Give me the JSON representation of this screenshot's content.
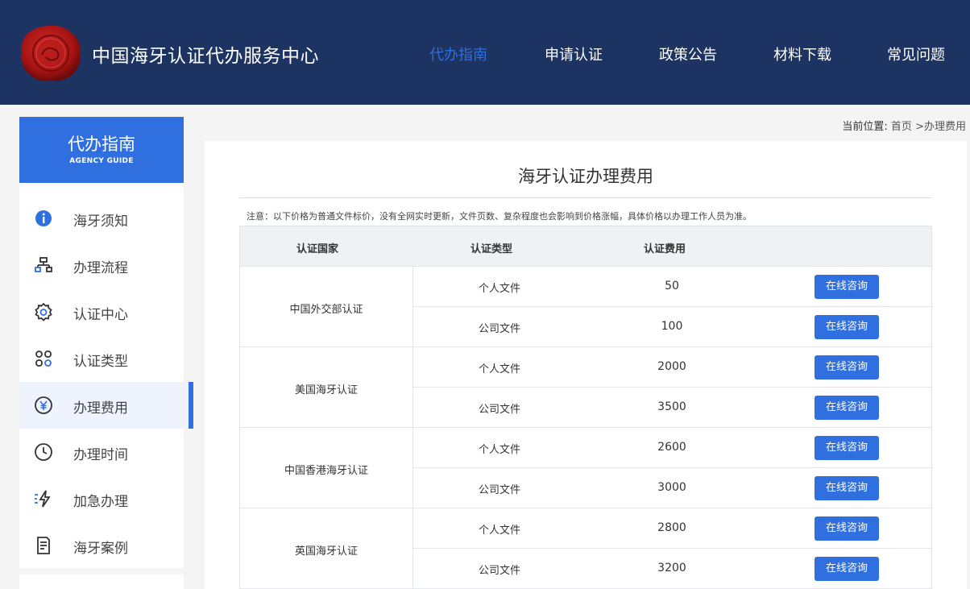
{
  "header": {
    "site_title": "中国海牙认证代办服务中心",
    "logo_icon": "wax-seal-icon",
    "nav": [
      {
        "label": "代办指南",
        "active": true
      },
      {
        "label": "申请认证",
        "active": false
      },
      {
        "label": "政策公告",
        "active": false
      },
      {
        "label": "材料下载",
        "active": false
      },
      {
        "label": "常见问题",
        "active": false
      }
    ]
  },
  "sidebar": {
    "title": "代办指南",
    "subtitle": "AGENCY GUIDE",
    "items": [
      {
        "label": "海牙须知",
        "icon": "info-icon"
      },
      {
        "label": "办理流程",
        "icon": "flowchart-icon"
      },
      {
        "label": "认证中心",
        "icon": "gear-badge-icon"
      },
      {
        "label": "认证类型",
        "icon": "category-icon"
      },
      {
        "label": "办理费用",
        "icon": "yuan-icon",
        "active": true
      },
      {
        "label": "办理时间",
        "icon": "clock-icon"
      },
      {
        "label": "加急办理",
        "icon": "lightning-icon"
      },
      {
        "label": "海牙案例",
        "icon": "document-icon"
      }
    ]
  },
  "breadcrumb": {
    "prefix": "当前位置:",
    "home": "首页",
    "sep": ">",
    "current": "办理费用"
  },
  "main": {
    "title": "海牙认证办理费用",
    "note": "注意：以下价格为普通文件标价，没有全网实时更新，文件页数、复杂程度也会影响到价格涨幅，具体价格以办理工作人员为准。",
    "table": {
      "headers": [
        "认证国家",
        "认证类型",
        "认证费用"
      ],
      "groups": [
        {
          "country": "中国外交部认证",
          "rows": [
            {
              "type": "个人文件",
              "fee": "50",
              "action": "在线咨询"
            },
            {
              "type": "公司文件",
              "fee": "100",
              "action": "在线咨询"
            }
          ]
        },
        {
          "country": "美国海牙认证",
          "rows": [
            {
              "type": "个人文件",
              "fee": "2000",
              "action": "在线咨询"
            },
            {
              "type": "公司文件",
              "fee": "3500",
              "action": "在线咨询"
            }
          ]
        },
        {
          "country": "中国香港海牙认证",
          "rows": [
            {
              "type": "个人文件",
              "fee": "2600",
              "action": "在线咨询"
            },
            {
              "type": "公司文件",
              "fee": "3000",
              "action": "在线咨询"
            }
          ]
        },
        {
          "country": "英国海牙认证",
          "rows": [
            {
              "type": "个人文件",
              "fee": "2800",
              "action": "在线咨询"
            },
            {
              "type": "公司文件",
              "fee": "3200",
              "action": "在线咨询"
            }
          ]
        }
      ]
    }
  },
  "colors": {
    "header_bg": "#1d3361",
    "accent": "#2f6fe0",
    "seal": "#b51a1a"
  }
}
